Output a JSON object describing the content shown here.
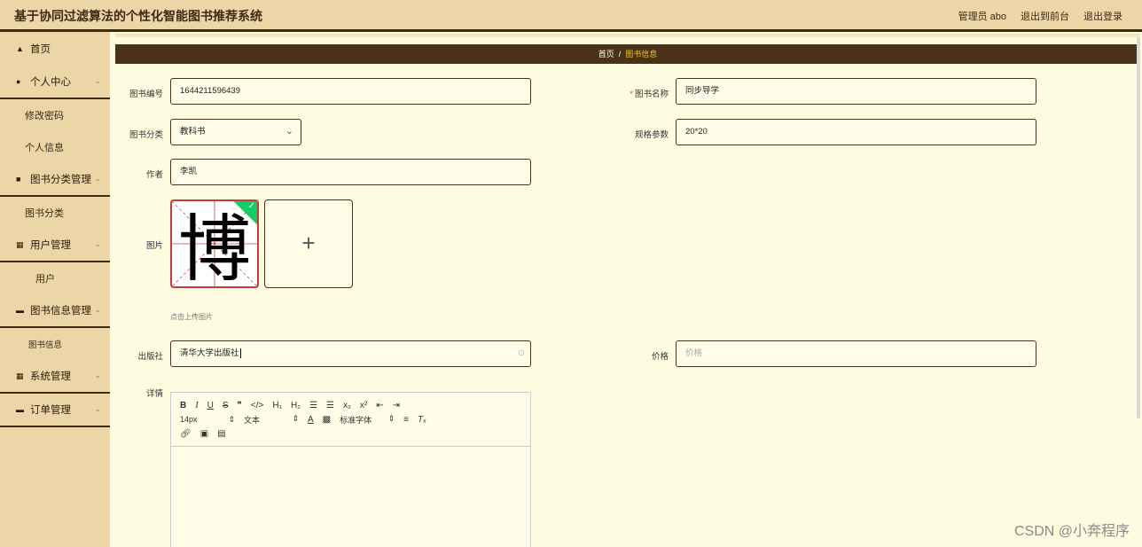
{
  "app": {
    "title": "基于协同过滤算法的个性化智能图书推荐系统",
    "top_links": [
      "管理员 abo",
      "退出到前台",
      "退出登录"
    ]
  },
  "sidebar": {
    "items": [
      {
        "label": "首页",
        "icon": "home-icon"
      },
      {
        "label": "个人中心",
        "icon": "user-icon",
        "children": [
          "修改密码",
          "个人信息"
        ]
      },
      {
        "label": "图书分类管理",
        "icon": "chat-icon",
        "children": [
          "图书分类"
        ]
      },
      {
        "label": "用户管理",
        "icon": "grid-icon",
        "children": [
          "用户"
        ]
      },
      {
        "label": "图书信息管理",
        "icon": "book-icon",
        "children": [
          "图书信息"
        ]
      },
      {
        "label": "系统管理",
        "icon": "grid-icon"
      },
      {
        "label": "订单管理",
        "icon": "book-icon"
      }
    ]
  },
  "breadcrumb": {
    "home": "首页",
    "separator": "/",
    "current": "图书信息"
  },
  "form": {
    "book_no": {
      "label": "图书编号",
      "value": "1644211596439"
    },
    "book_name": {
      "label": "图书名称",
      "required_mark": "*",
      "value": "同步导学"
    },
    "category": {
      "label": "图书分类",
      "value": "教科书"
    },
    "spec": {
      "label": "规格参数",
      "value": "20*20"
    },
    "author": {
      "label": "作者",
      "value": "李凯"
    },
    "image": {
      "label": "图片",
      "glyph": "博",
      "hint": "点击上传图片",
      "add": "+"
    },
    "publisher": {
      "label": "出版社",
      "value": "清华大学出版社"
    },
    "price": {
      "label": "价格",
      "placeholder": "价格"
    },
    "detail": {
      "label": "详情"
    }
  },
  "editor": {
    "row1": [
      "B",
      "I",
      "U",
      "S",
      "❞",
      "</>",
      "H₁",
      "H₂",
      "☰",
      "☰",
      "x₂",
      "x²",
      "⇤",
      "⇥"
    ],
    "font_size": "14px",
    "text_style": "文本",
    "font_family": "标准字体"
  },
  "watermark": "CSDN @小奔程序",
  "colors": {
    "accent_dark": "#4a3218",
    "sidebar_bg": "#ecd5a6",
    "page_bg": "#fdfbe0",
    "crumb_current": "#f0c040",
    "success": "#13ce66"
  }
}
